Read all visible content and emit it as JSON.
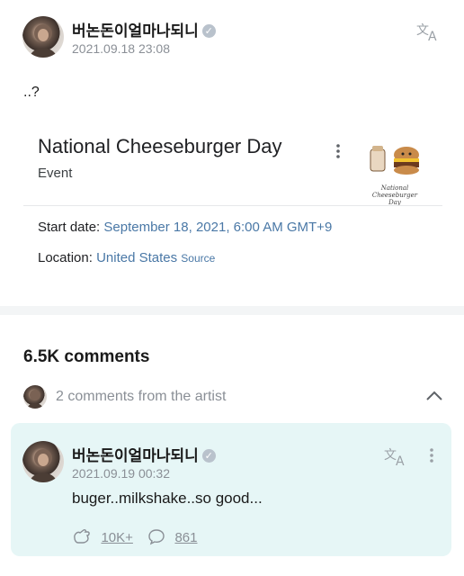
{
  "post": {
    "author": "버논돈이얼마나되니",
    "timestamp": "2021.09.18 23:08",
    "text": "..?"
  },
  "event_card": {
    "title": "National Cheeseburger Day",
    "subtitle": "Event",
    "start_label": "Start date:",
    "start_value": "September 18, 2021, 6:00 AM GMT+9",
    "location_label": "Location:",
    "location_value": "United States",
    "source_label": "Source",
    "image_text_line1": "National",
    "image_text_line2": "Cheeseburger Day"
  },
  "comments": {
    "count_label": "6.5K comments",
    "artist_count": "2",
    "artist_label": "comments from the artist"
  },
  "artist_comment": {
    "author": "버논돈이얼마나되니",
    "timestamp": "2021.09.19 00:32",
    "text": "buger..milkshake..so good...",
    "likes": "10K+",
    "replies": "861"
  },
  "colors": {
    "highlight_bg": "#e6f6f6",
    "link": "#4a78a6",
    "muted": "#8a8f96"
  }
}
